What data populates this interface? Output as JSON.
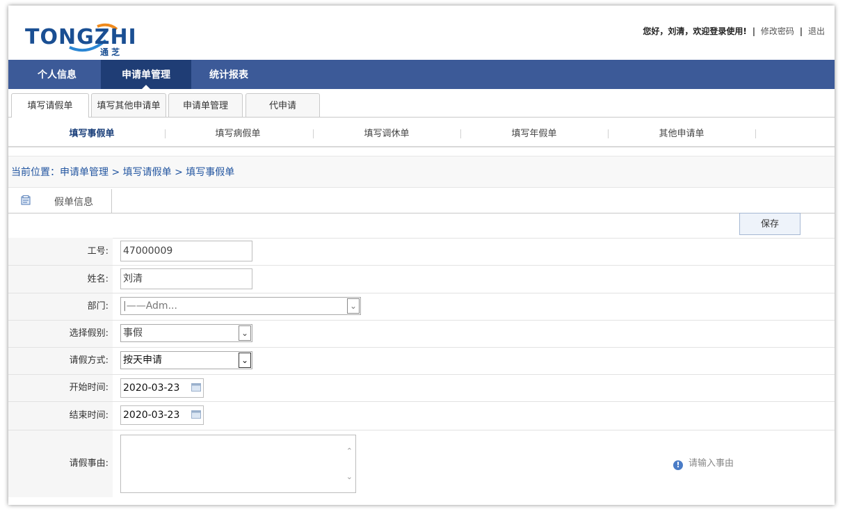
{
  "logo": {
    "text": "TONGZHI",
    "sub": "通 芝"
  },
  "userbar": {
    "greeting": "您好，刘清，欢迎登录使用!",
    "change_password": "修改密码",
    "logout": "退出",
    "separator": "|"
  },
  "nav": {
    "items": [
      {
        "label": "个人信息"
      },
      {
        "label": "申请单管理"
      },
      {
        "label": "统计报表"
      }
    ]
  },
  "tabs": [
    {
      "label": "填写请假单"
    },
    {
      "label": "填写其他申请单"
    },
    {
      "label": "申请单管理"
    },
    {
      "label": "代申请"
    }
  ],
  "subtabs": [
    {
      "label": "填写事假单"
    },
    {
      "label": "填写病假单"
    },
    {
      "label": "填写调休单"
    },
    {
      "label": "填写年假单"
    },
    {
      "label": "其他申请单"
    }
  ],
  "breadcrumb": "当前位置：申请单管理 > 填写请假单 > 填写事假单",
  "section": {
    "label": "假单信息",
    "icon": "document-icon"
  },
  "toolbar": {
    "save_label": "保存"
  },
  "form": {
    "employee_id": {
      "label": "工号:",
      "value": "47000009"
    },
    "name": {
      "label": "姓名:",
      "value": "刘清"
    },
    "department": {
      "label": "部门:",
      "value": "|——Adm..."
    },
    "leave_type": {
      "label": "选择假别:",
      "value": "事假"
    },
    "leave_method": {
      "label": "请假方式:",
      "value": "按天申请"
    },
    "start_time": {
      "label": "开始时间:",
      "value": "2020-03-23"
    },
    "end_time": {
      "label": "结束时间:",
      "value": "2020-03-23"
    },
    "reason": {
      "label": "请假事由:",
      "value": "",
      "hint": "请输入事由"
    }
  },
  "colors": {
    "nav_bg": "#3c5a98",
    "nav_active": "#1f3d75",
    "brand": "#1a4f93",
    "link": "#2255a0"
  }
}
